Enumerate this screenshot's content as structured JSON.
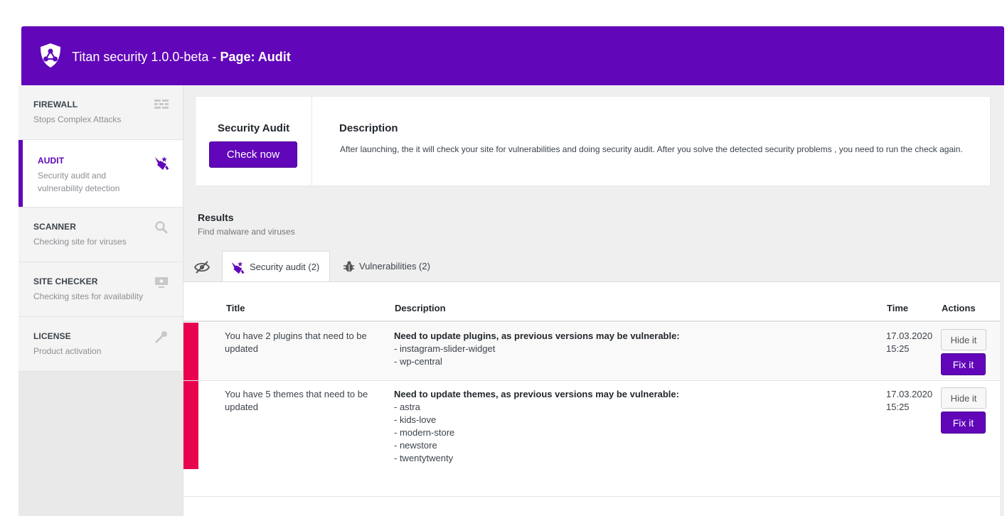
{
  "header": {
    "app_name": "Titan security 1.0.0-beta - ",
    "page_label": "Page: Audit"
  },
  "colors": {
    "brand": "#6106b9",
    "flag": "#e8034f"
  },
  "sidebar": {
    "items": [
      {
        "title": "FIREWALL",
        "desc": "Stops Complex Attacks",
        "icon": "firewall-icon"
      },
      {
        "title": "AUDIT",
        "desc": "Security audit and vulnerability detection",
        "icon": "audit-icon"
      },
      {
        "title": "SCANNER",
        "desc": "Checking site for viruses",
        "icon": "search-icon"
      },
      {
        "title": "SITE CHECKER",
        "desc": "Checking sites for availability",
        "icon": "monitor-icon"
      },
      {
        "title": "LICENSE",
        "desc": "Product activation",
        "icon": "key-icon"
      }
    ],
    "active": "AUDIT"
  },
  "audit_box": {
    "heading": "Security Audit",
    "check_button": "Check now",
    "desc_heading": "Description",
    "desc_text": "After launching, the it will check your site for vulnerabilities and doing security audit. After you solve the detected security problems , you need to run the check again."
  },
  "results": {
    "title": "Results",
    "subtitle": "Find malware and viruses",
    "tabs": [
      {
        "label": "Security audit (2)",
        "icon": "audit-icon",
        "active": true
      },
      {
        "label": "Vulnerabilities (2)",
        "icon": "bug-icon",
        "active": false
      }
    ],
    "hidden_tab_icon": "eye-slash-icon",
    "columns": [
      "Title",
      "Description",
      "Time",
      "Actions"
    ],
    "rows": [
      {
        "title": "You have 2 plugins that need to be updated",
        "desc_head": "Need to update plugins, as previous versions may be vulnerable:",
        "desc_items": [
          "- instagram-slider-widget",
          "- wp-central"
        ],
        "date": "17.03.2020",
        "time": "15:25",
        "hide_label": "Hide it",
        "fix_label": "Fix it"
      },
      {
        "title": "You have 5 themes that need to be updated",
        "desc_head": "Need to update themes, as previous versions may be vulnerable:",
        "desc_items": [
          "- astra",
          "- kids-love",
          "- modern-store",
          "- newstore",
          "- twentytwenty"
        ],
        "date": "17.03.2020",
        "time": "15:25",
        "hide_label": "Hide it",
        "fix_label": "Fix it"
      }
    ]
  }
}
